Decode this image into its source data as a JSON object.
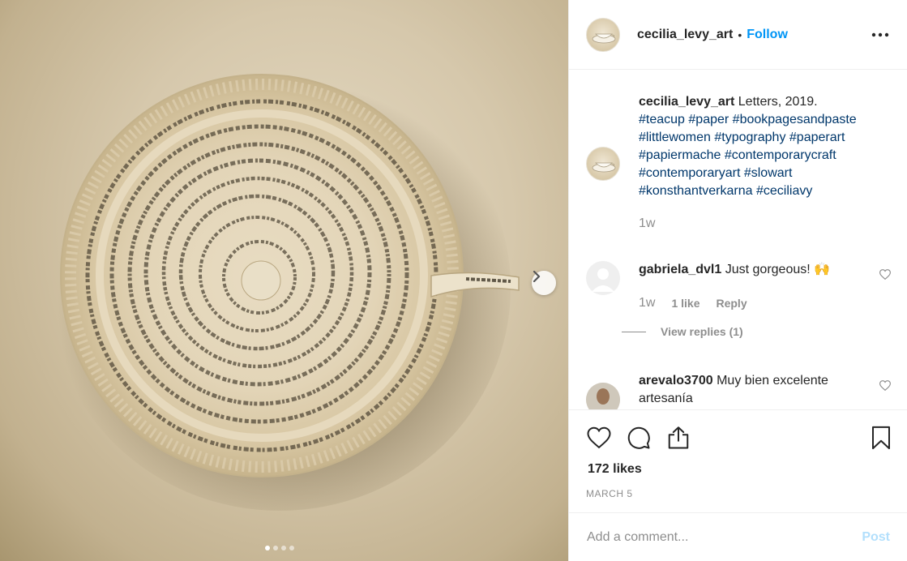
{
  "post": {
    "image_alt_icon": "paper-teacup-photo",
    "image_dots": 4,
    "active_dot": 0
  },
  "header": {
    "username": "cecilia_levy_art",
    "separator": "•",
    "follow_label": "Follow",
    "more_icon": "more-options-icon"
  },
  "caption": {
    "username": "cecilia_levy_art",
    "text": "Letters, 2019.",
    "hashtags": [
      "#teacup",
      "#paper",
      "#bookpagesandpaste",
      "#littlewomen",
      "#typography",
      "#paperart",
      "#papiermache",
      "#contemporarycraft",
      "#contemporaryart",
      "#slowart",
      "#konsthantverkarna",
      "#ceciliavy"
    ],
    "time": "1w"
  },
  "comments": [
    {
      "username": "gabriela_dvl1",
      "text": "Just gorgeous! 🙌",
      "time": "1w",
      "likes": "1 like",
      "reply_label": "Reply",
      "view_replies": "View replies (1)"
    },
    {
      "username": "arevalo3700",
      "text": "Muy bien excelente artesanía"
    }
  ],
  "actions": {
    "likes": "172 likes",
    "date": "MARCH 5"
  },
  "comment_box": {
    "placeholder": "Add a comment...",
    "post_label": "Post"
  }
}
